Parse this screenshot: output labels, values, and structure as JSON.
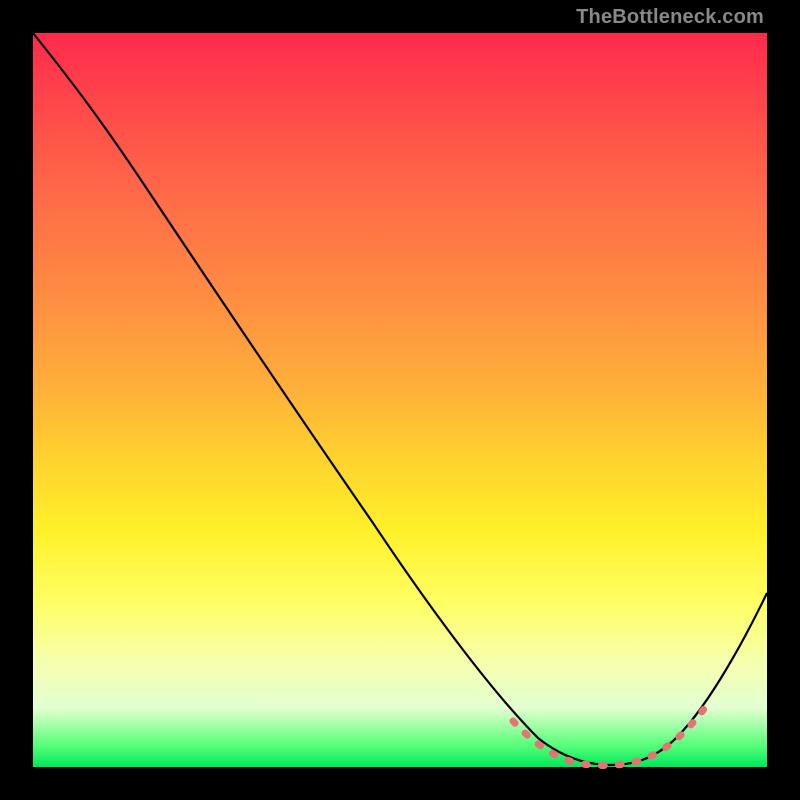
{
  "attribution": "TheBottleneck.com",
  "chart_data": {
    "type": "line",
    "title": "",
    "xlabel": "",
    "ylabel": "",
    "ylim": [
      0,
      100
    ],
    "x": [
      0,
      5,
      10,
      15,
      20,
      25,
      30,
      35,
      40,
      45,
      50,
      55,
      60,
      65,
      68,
      72,
      76,
      80,
      84,
      88,
      92,
      96,
      100
    ],
    "values": [
      100,
      96,
      90,
      83,
      76,
      68,
      60,
      52,
      44,
      36,
      28,
      21,
      14,
      8,
      4,
      1,
      0,
      0,
      1,
      4,
      9,
      16,
      24
    ],
    "highlight_range_x": [
      65,
      90
    ],
    "background_gradient": {
      "top": "#ff2a4c",
      "mid_upper": "#ff8d42",
      "mid": "#fff12a",
      "mid_lower": "#e2ffd0",
      "bottom": "#00e85a"
    },
    "accent_dash_color": "#e57373",
    "frame_color": "#000000"
  }
}
